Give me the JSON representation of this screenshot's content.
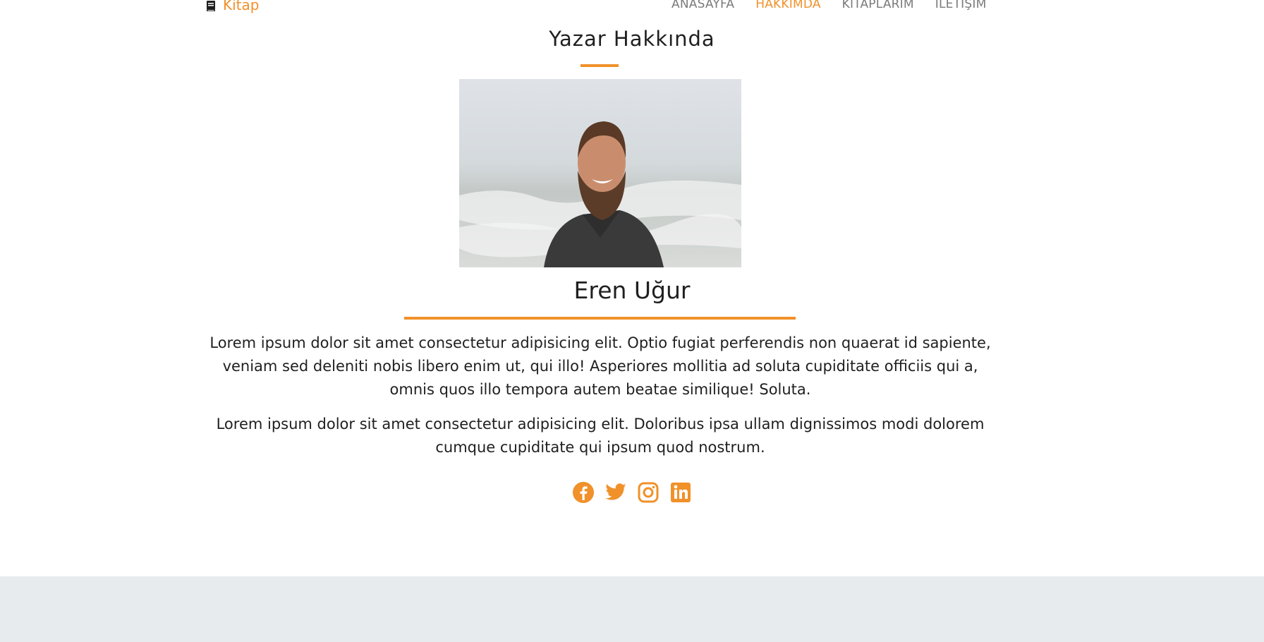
{
  "brand": {
    "name": "Kitap",
    "icon": "book-icon"
  },
  "nav": {
    "items": [
      {
        "label": "ANASAYFA",
        "active": false
      },
      {
        "label": "HAKKIMDA",
        "active": true
      },
      {
        "label": "KITAPLARIM",
        "active": false
      },
      {
        "label": "İLETİŞİM",
        "active": false
      }
    ]
  },
  "about": {
    "section_title": "Yazar Hakkında",
    "author_name": "Eren Uğur",
    "paragraphs": [
      "Lorem ipsum dolor sit amet consectetur adipisicing elit. Optio fugiat perferendis non quaerat id sapiente, veniam sed deleniti nobis libero enim ut, qui illo! Asperiores mollitia ad soluta cupiditate officiis qui a, omnis quos illo tempora autem beatae similique! Soluta.",
      "Lorem ipsum dolor sit amet consectetur adipisicing elit. Doloribus ipsa ullam dignissimos modi dolorem cumque cupiditate qui ipsum quod nostrum."
    ],
    "socials": [
      "facebook-icon",
      "twitter-icon",
      "instagram-icon",
      "linkedin-icon"
    ]
  },
  "colors": {
    "accent": "#f0912a",
    "text": "#1f1f1f",
    "nav_text": "#7a7a7a",
    "footer_bg": "#e7ebee"
  }
}
